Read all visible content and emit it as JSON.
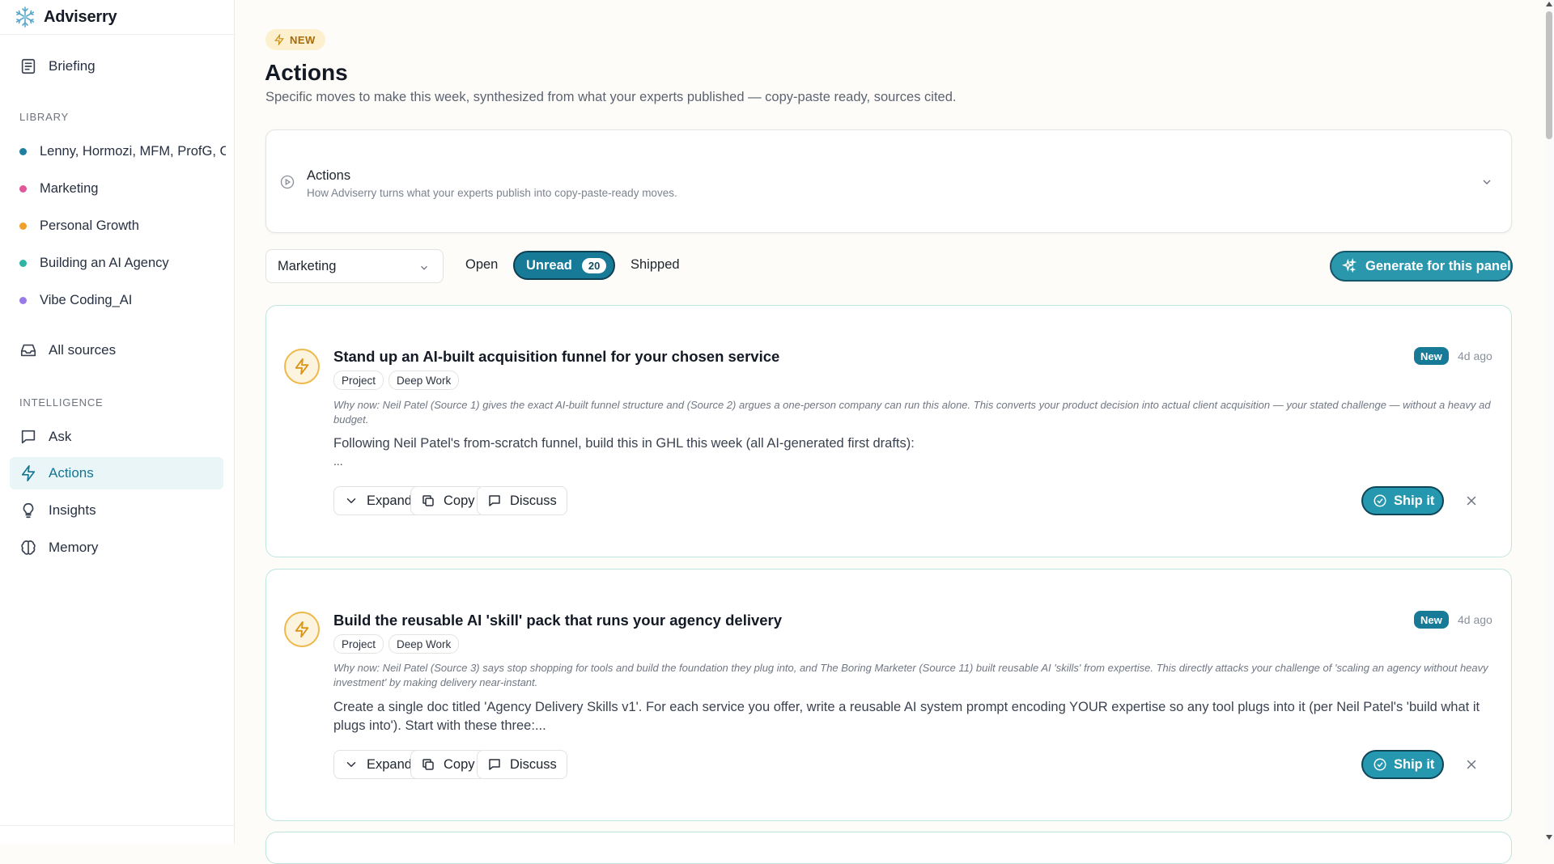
{
  "app": {
    "name": "Adviserry"
  },
  "sidebar": {
    "briefing": "Briefing",
    "library_label": "LIBRARY",
    "library": [
      {
        "label": "Lenny, Hormozi, MFM, ProfG, C",
        "color": "#1f7fa3"
      },
      {
        "label": "Marketing",
        "color": "#e0589a"
      },
      {
        "label": "Personal Growth",
        "color": "#f0a028"
      },
      {
        "label": "Building an AI Agency",
        "color": "#2fb5a6"
      },
      {
        "label": "Vibe Coding_AI",
        "color": "#9a7ae8"
      }
    ],
    "all_sources": "All sources",
    "intelligence_label": "INTELLIGENCE",
    "ask": "Ask",
    "actions": "Actions",
    "insights": "Insights",
    "memory": "Memory"
  },
  "header": {
    "badge": "NEW",
    "title": "Actions",
    "subtitle": "Specific moves to make this week, synthesized from what your experts published — copy-paste ready, sources cited."
  },
  "info_card": {
    "title": "Actions",
    "subtitle": "How Adviserry turns what your experts publish into copy-paste-ready moves."
  },
  "filters": {
    "panel_select": "Marketing",
    "tab_open": "Open",
    "tab_unread": "Unread",
    "unread_count": "20",
    "tab_shipped": "Shipped",
    "generate_button": "Generate for this panel"
  },
  "actions": [
    {
      "title": "Stand up an AI-built acquisition funnel for your chosen service",
      "tags": [
        "Project",
        "Deep Work"
      ],
      "status": "New",
      "time": "4d ago",
      "why": "Why now: Neil Patel (Source 1) gives the exact AI-built funnel structure and (Source 2) argues a one-person company can run this alone. This converts your product decision into actual client acquisition — your stated challenge — without a heavy ad budget.",
      "body": "Following Neil Patel's from-scratch funnel, build this in GHL this week (all AI-generated first drafts):",
      "body2": "...",
      "expand": "Expand",
      "copy": "Copy",
      "discuss": "Discuss",
      "ship": "Ship it"
    },
    {
      "title": "Build the reusable AI 'skill' pack that runs your agency delivery",
      "tags": [
        "Project",
        "Deep Work"
      ],
      "status": "New",
      "time": "4d ago",
      "why": "Why now: Neil Patel (Source 3) says stop shopping for tools and build the foundation they plug into, and The Boring Marketer (Source 11) built reusable AI 'skills' from expertise. This directly attacks your challenge of 'scaling an agency without heavy investment' by making delivery near-instant.",
      "body": "Create a single doc titled 'Agency Delivery Skills v1'. For each service you offer, write a reusable AI system prompt encoding YOUR expertise so any tool plugs into it (per Neil Patel's 'build what it plugs into'). Start with these three:...",
      "expand": "Expand",
      "copy": "Copy",
      "discuss": "Discuss",
      "ship": "Ship it"
    }
  ]
}
